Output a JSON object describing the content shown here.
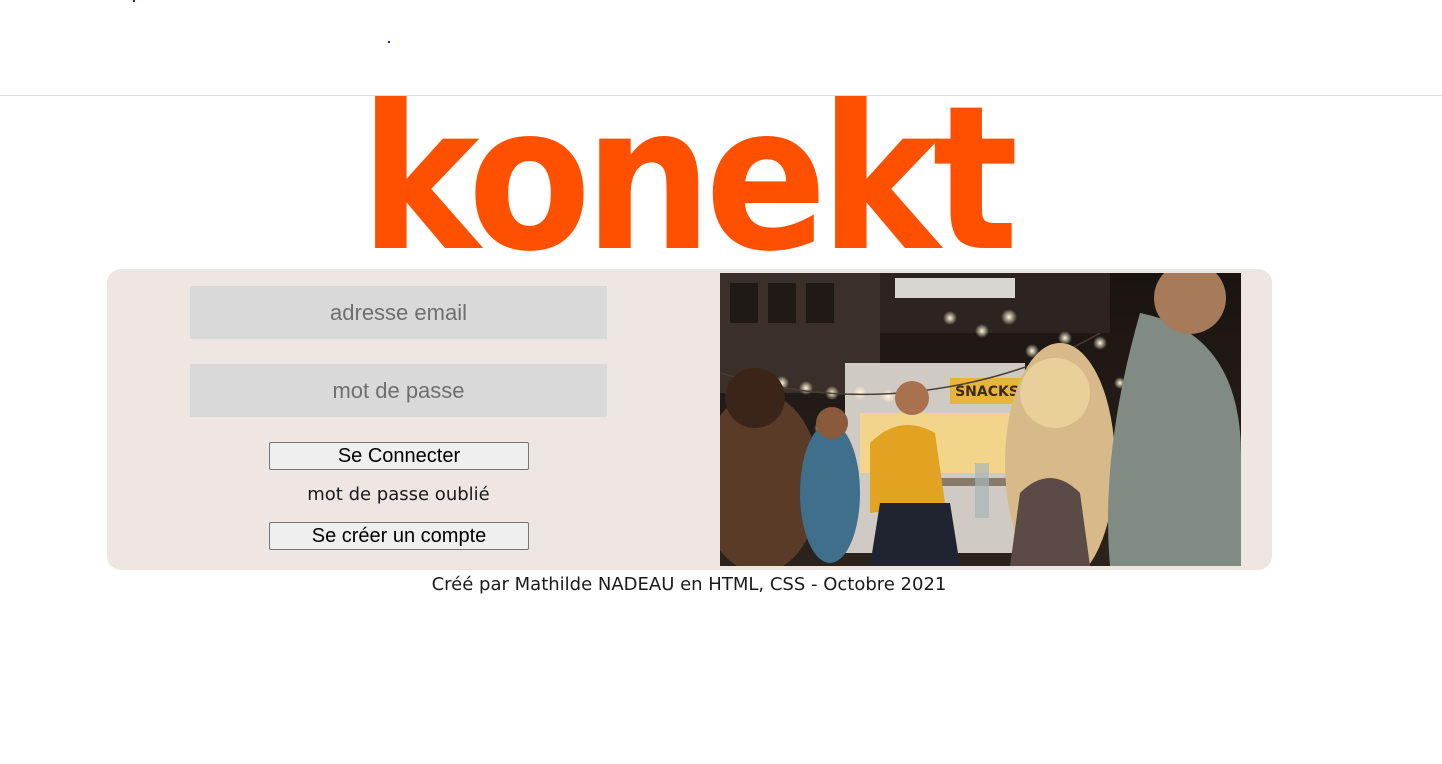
{
  "brand": {
    "logo_text": "konekt",
    "accent_color": "#ff5000"
  },
  "login_form": {
    "email_placeholder": "adresse email",
    "password_placeholder": "mot de passe",
    "login_button": "Se Connecter",
    "forgot_password": "mot de passe oublié",
    "signup_button": "Se créer un compte"
  },
  "photo": {
    "sign_text": "SNACKS"
  },
  "footer": {
    "credit": "Créé par Mathilde NADEAU en HTML, CSS - Octobre 2021"
  }
}
